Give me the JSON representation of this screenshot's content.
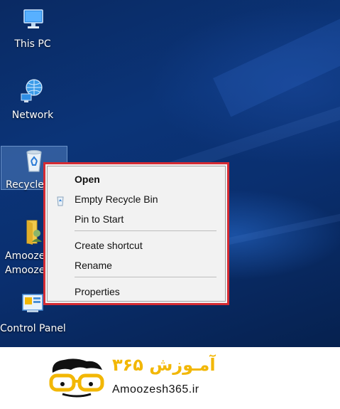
{
  "desktop": {
    "icons": [
      {
        "label": "This PC",
        "icon": "this-pc-icon"
      },
      {
        "label": "Network",
        "icon": "network-icon"
      },
      {
        "label": "Recycle Bin",
        "visible_label": "Recycle",
        "icon": "recycle-bin-icon",
        "selected": true
      },
      {
        "label_line1": "Amoozes",
        "label_line2": "Amooze",
        "icon": "user-folder-icon"
      },
      {
        "label": "Control Panel",
        "icon": "control-panel-icon"
      }
    ]
  },
  "context_menu": {
    "items": [
      {
        "label": "Open",
        "bold": true
      },
      {
        "label": "Empty Recycle Bin",
        "icon": "recycle-bin-small-icon"
      },
      {
        "label": "Pin to Start"
      },
      {
        "label": "Create shortcut"
      },
      {
        "label": "Rename"
      },
      {
        "label": "Properties"
      }
    ],
    "highlight_color": "#d52b33"
  },
  "footer": {
    "brand_persian": "آمـوزش ۳۶۵",
    "brand_url": "Amoozesh365.ir",
    "brand_color": "#f2b705"
  }
}
